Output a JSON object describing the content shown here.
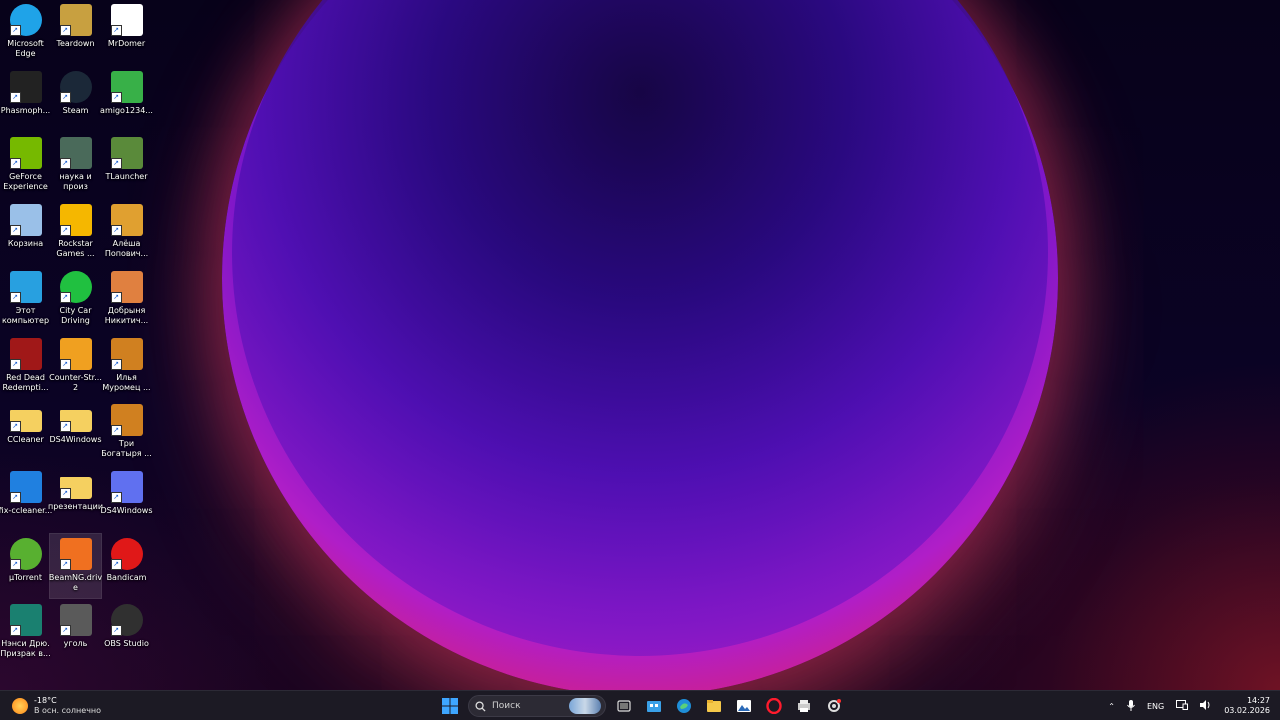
{
  "desktop": {
    "icons": [
      {
        "label": "Microsoft Edge",
        "icon": "edge-icon",
        "color": "#1fa3e8"
      },
      {
        "label": "Teardown",
        "icon": "teardown-icon",
        "color": "#c8a040"
      },
      {
        "label": "MrDomer",
        "icon": "mrdomer-icon",
        "color": "#ffffff"
      },
      {
        "label": "Phasmoph...",
        "icon": "phasmophobia-icon",
        "color": "#222222"
      },
      {
        "label": "Steam",
        "icon": "steam-icon",
        "color": "#1b2838"
      },
      {
        "label": "amigo1234...",
        "icon": "amigo-icon",
        "color": "#38b048"
      },
      {
        "label": "GeForce Experience",
        "icon": "geforce-icon",
        "color": "#76b900"
      },
      {
        "label": "наука и произ",
        "icon": "video-file-icon",
        "color": "#4a6a5a"
      },
      {
        "label": "TLauncher",
        "icon": "tlauncher-icon",
        "color": "#5a8a3a"
      },
      {
        "label": "Корзина",
        "icon": "recycle-bin-icon",
        "color": "#9ac0e8"
      },
      {
        "label": "Rockstar Games ...",
        "icon": "rockstar-icon",
        "color": "#f5b700"
      },
      {
        "label": "Алёша Попович...",
        "icon": "alesha-icon",
        "color": "#e0a030"
      },
      {
        "label": "Этот компьютер",
        "icon": "this-pc-icon",
        "color": "#28a0e0"
      },
      {
        "label": "City Car Driving",
        "icon": "citycar-icon",
        "color": "#20c040"
      },
      {
        "label": "Добрыня Никитич...",
        "icon": "dobrynya-icon",
        "color": "#e08040"
      },
      {
        "label": "Red Dead Redempti...",
        "icon": "rdr-icon",
        "color": "#a01818"
      },
      {
        "label": "Counter-Str... 2",
        "icon": "cs2-icon",
        "color": "#f0a020"
      },
      {
        "label": "Илья Муромец ...",
        "icon": "ilya-icon",
        "color": "#d08020"
      },
      {
        "label": "CCleaner",
        "icon": "folder-icon",
        "color": "#f5d060"
      },
      {
        "label": "DS4Windows",
        "icon": "folder-icon",
        "color": "#f5d060"
      },
      {
        "label": "Три Богатыря ...",
        "icon": "tri-bogatyrya-icon",
        "color": "#d08020"
      },
      {
        "label": "fix-ccleaner...",
        "icon": "fix-ccleaner-icon",
        "color": "#2080e0"
      },
      {
        "label": "презентации",
        "icon": "folder-icon",
        "color": "#f5d060"
      },
      {
        "label": "DS4Windows",
        "icon": "gamepad-icon",
        "color": "#6070f0"
      },
      {
        "label": "µTorrent",
        "icon": "utorrent-icon",
        "color": "#58b030"
      },
      {
        "label": "BeamNG.drive",
        "icon": "beamng-icon",
        "color": "#f07020"
      },
      {
        "label": "Bandicam",
        "icon": "bandicam-icon",
        "color": "#e01818"
      },
      {
        "label": "Нэнси Дрю. Призрак в...",
        "icon": "nancy-drew-icon",
        "color": "#1a8070"
      },
      {
        "label": "уголь",
        "icon": "video-file-icon",
        "color": "#5a5a5a"
      },
      {
        "label": "OBS Studio",
        "icon": "obs-icon",
        "color": "#303030"
      }
    ]
  },
  "taskbar": {
    "weather": {
      "temp": "-18°C",
      "condition": "В осн. солнечно"
    },
    "search_placeholder": "Поиск",
    "tray": {
      "language": "ENG",
      "time": "14:27",
      "date": "03.02.2026"
    }
  }
}
